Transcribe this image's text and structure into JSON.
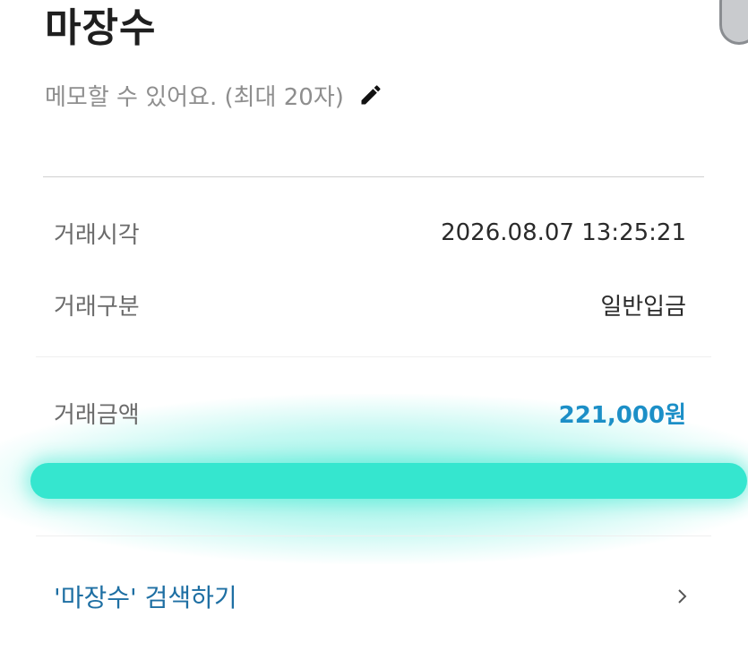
{
  "header": {
    "title": "마장수",
    "memo_placeholder": "메모할 수 있어요. (최대 20자)",
    "edit_icon": "pencil-icon"
  },
  "details": [
    {
      "label": "거래시각",
      "value": "2026.08.07 13:25:21"
    },
    {
      "label": "거래구분",
      "value": "일반입금"
    },
    {
      "label": "거래금액",
      "value": "221,000원"
    }
  ],
  "search": {
    "label": "'마장수' 검색하기",
    "icon": "chevron-right-icon"
  },
  "colors": {
    "amount": "#1c8fc7",
    "search_link": "#1e6fa3",
    "highlight": "#35e6cf"
  }
}
